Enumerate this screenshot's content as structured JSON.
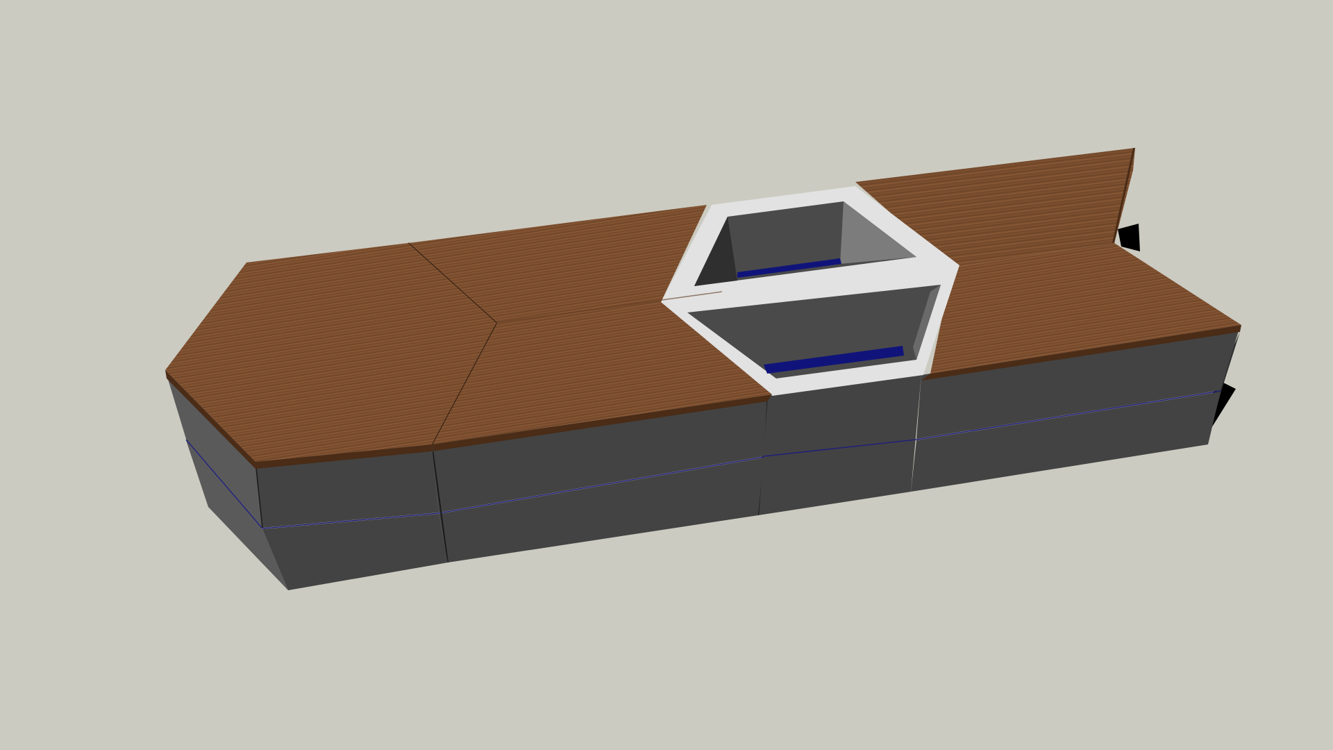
{
  "scene": {
    "background_color": "#CBCBC1",
    "wood_color": "#7C4F2F",
    "wood_grain_dark": "#5E3A20",
    "wood_grain_light": "#A06A44",
    "cabinet_color": "#434343",
    "cabinet_edge_color": "#2A2A2A",
    "planter_rim_color": "#E2E2E2",
    "planter_inner_color": "#7A7A7A",
    "planter_inner_dark": "#3F3F3F",
    "water_color": "#10147A",
    "shadow_color": "#000000",
    "objects": [
      "bench-module-hexagonal-end",
      "bench-module-chevron",
      "planter-box-hexagonal",
      "bench-module-angled-end"
    ]
  }
}
